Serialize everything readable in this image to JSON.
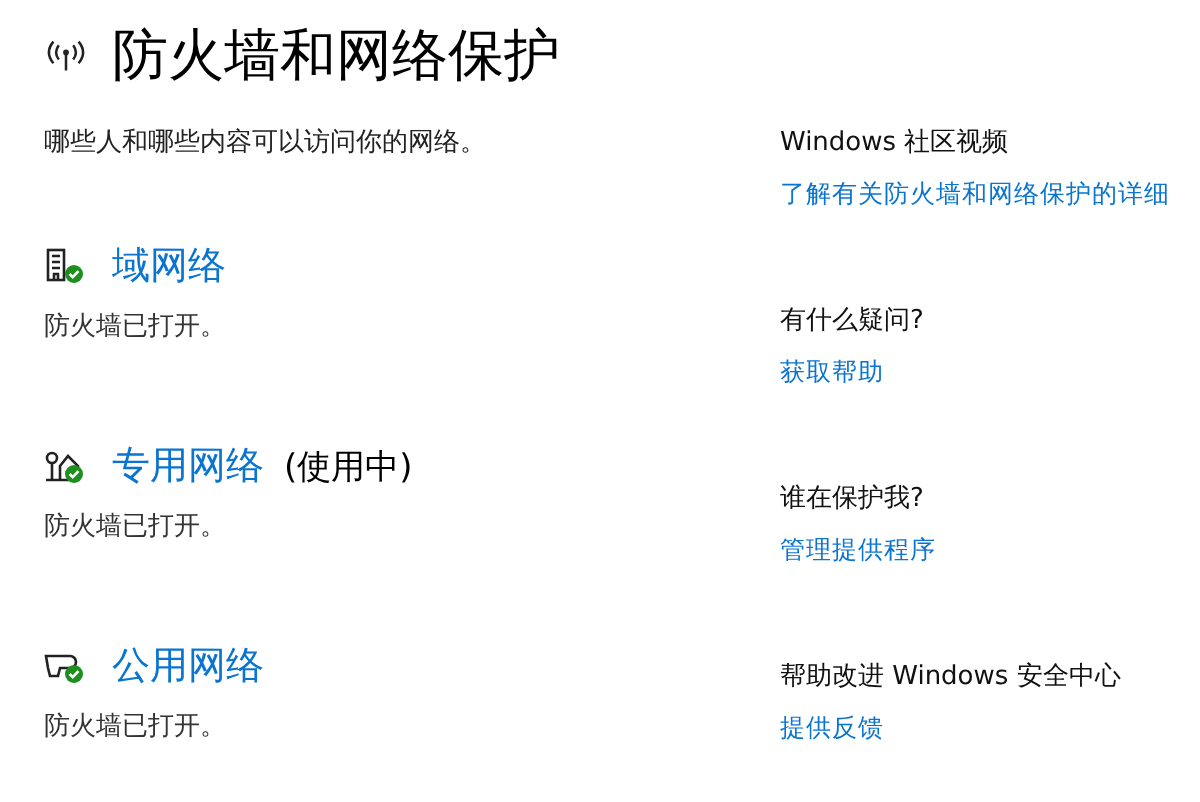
{
  "page": {
    "title": "防火墙和网络保护",
    "subtitle": "哪些人和哪些内容可以访问你的网络。"
  },
  "networks": [
    {
      "kind": "domain",
      "name": "域网络",
      "status": "防火墙已打开。",
      "protected": true
    },
    {
      "kind": "private",
      "name": "专用网络",
      "active_note": "(使用中)",
      "status": "防火墙已打开。",
      "protected": true
    },
    {
      "kind": "public",
      "name": "公用网络",
      "status": "防火墙已打开。",
      "protected": true
    }
  ],
  "side": [
    {
      "heading": "Windows 社区视频",
      "link": "了解有关防火墙和网络保护的详细"
    },
    {
      "heading": "有什么疑问?",
      "link": "获取帮助"
    },
    {
      "heading": "谁在保护我?",
      "link": "管理提供程序"
    },
    {
      "heading": "帮助改进 Windows 安全中心",
      "link": "提供反馈"
    }
  ]
}
